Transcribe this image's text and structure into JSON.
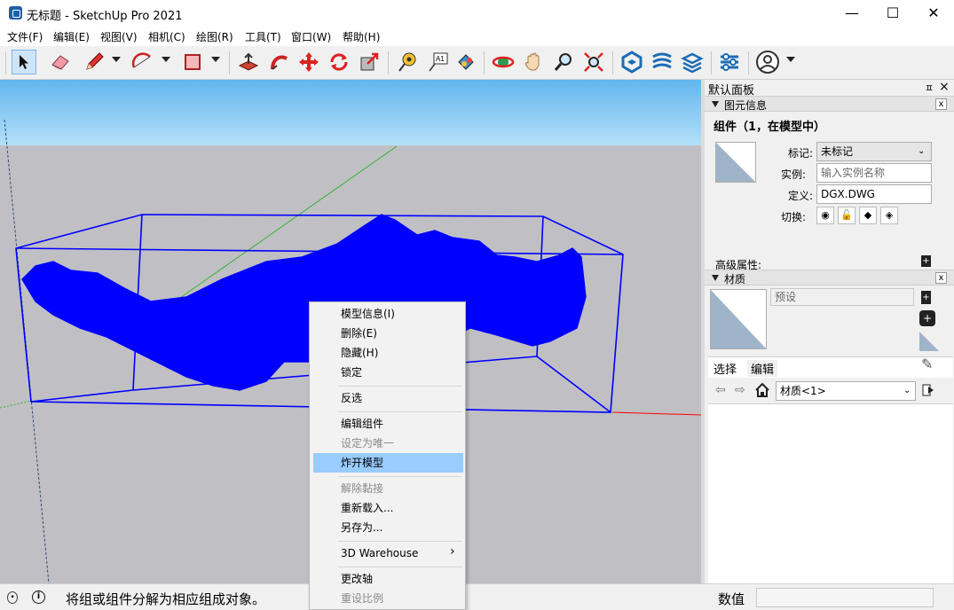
{
  "window": {
    "title": "无标题 - SketchUp Pro 2021",
    "min_glyph": "—",
    "max_glyph": "☐",
    "close_glyph": "✕"
  },
  "menu": [
    "文件(F)",
    "编辑(E)",
    "视图(V)",
    "相机(C)",
    "绘图(R)",
    "工具(T)",
    "窗口(W)",
    "帮助(H)"
  ],
  "toolbar": {
    "tools": [
      "select-icon",
      "eraser-icon",
      "pencil-icon",
      "arc-icon",
      "shape-icon",
      "push-pull-icon",
      "follow-me-icon",
      "move-icon",
      "rotate-icon",
      "scale-icon",
      "tape-measure-icon",
      "text-icon",
      "paint-bucket-icon",
      "orbit-icon",
      "pan-icon",
      "zoom-icon",
      "zoom-extents-icon",
      "warehouse-icon",
      "extension-warehouse-icon",
      "layout-icon",
      "extension-manager-icon",
      "account-icon"
    ]
  },
  "context_menu": {
    "items": [
      {
        "label": "模型信息(I)",
        "enabled": true
      },
      {
        "label": "删除(E)",
        "enabled": true
      },
      {
        "label": "隐藏(H)",
        "enabled": true
      },
      {
        "label": "锁定",
        "enabled": true
      },
      {
        "label": "反选",
        "enabled": true
      },
      {
        "label": "编辑组件",
        "enabled": true
      },
      {
        "label": "设定为唯一",
        "enabled": false
      },
      {
        "label": "炸开模型",
        "enabled": true,
        "highlighted": true
      },
      {
        "label": "解除黏接",
        "enabled": false
      },
      {
        "label": "重新载入...",
        "enabled": true
      },
      {
        "label": "另存为...",
        "enabled": true
      },
      {
        "label": "3D Warehouse",
        "enabled": true,
        "submenu": true
      },
      {
        "label": "更改轴",
        "enabled": true
      },
      {
        "label": "重设比例",
        "enabled": false
      }
    ],
    "submenu_glyph": "›",
    "highlight_color": "#99ccff"
  },
  "panel": {
    "title": "默认面板",
    "pin_glyph": "ㅍ",
    "close_glyph": "×",
    "entity_info": {
      "header": "图元信息",
      "heading": "组件（1，在模型中）",
      "tag_label": "标记:",
      "tag_value": "未标记",
      "instance_label": "实例:",
      "instance_placeholder": "输入实例名称",
      "definition_label": "定义:",
      "definition_value": "DGX.DWG",
      "toggle_label": "切换:",
      "advanced_label": "高级属性:"
    },
    "materials": {
      "header": "材质",
      "name_placeholder": "预设",
      "tab_select": "选择",
      "tab_edit": "编辑",
      "collection_value": "材质<1>"
    }
  },
  "status": {
    "message": "将组或组件分解为相应组成对象。",
    "measurements_label": "数值"
  },
  "colors": {
    "sky_top": "#63b6ee",
    "sky_bottom": "#b4e0f8",
    "ground": "#c0c0c4",
    "model_blue": "#0000ff",
    "axis_green": "#34b234",
    "axis_red": "#ff0000",
    "swatch_gray": "#9fb4c8"
  }
}
